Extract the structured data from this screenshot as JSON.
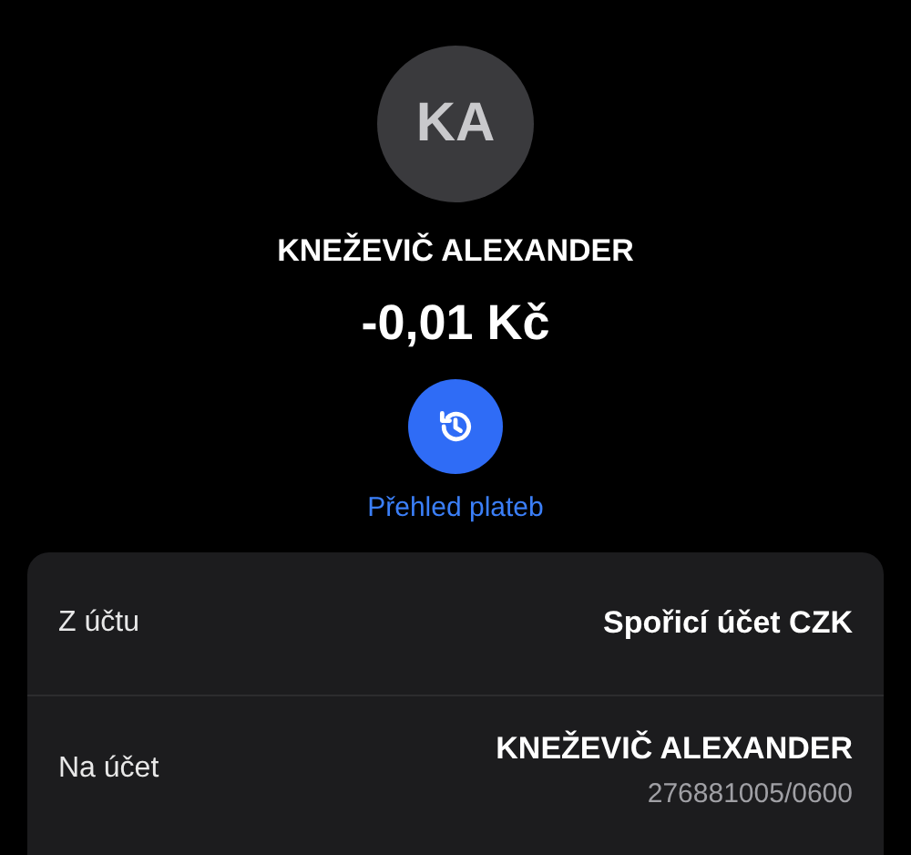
{
  "contact": {
    "initials": "KA",
    "name": "KNEŽEVIČ ALEXANDER",
    "amount": "-0,01 Kč"
  },
  "history_link": {
    "label": "Přehled plateb"
  },
  "details": [
    {
      "label": "Z účtu",
      "value": "Spořicí účet CZK"
    },
    {
      "label": "Na účet",
      "value": "KNEŽEVIČ ALEXANDER",
      "sub": "276881005/0600"
    }
  ]
}
